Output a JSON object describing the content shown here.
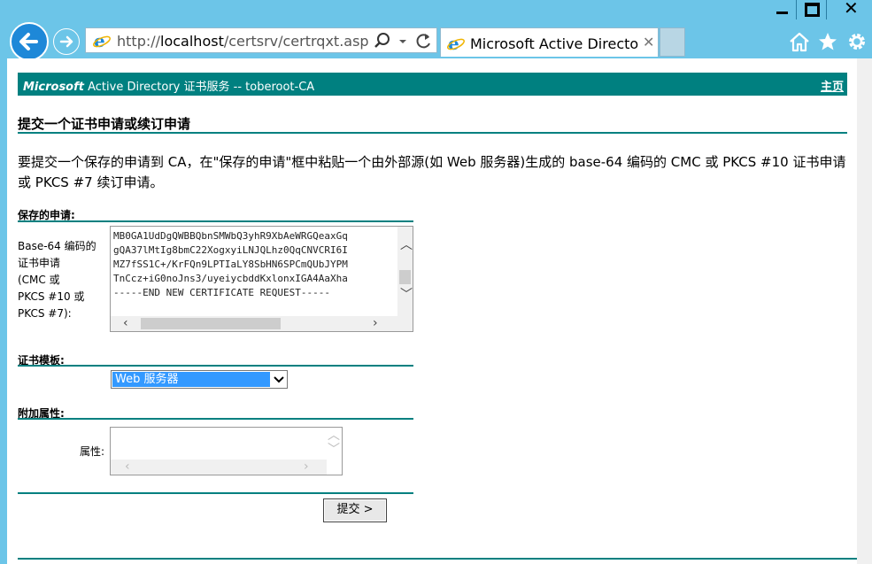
{
  "browser": {
    "url_prefix": "http://",
    "url_host": "localhost",
    "url_path": "/certsrv/certrqxt.asp",
    "tab_title": "Microsoft Active Directo...",
    "tab_close": "✕"
  },
  "header": {
    "brand": "Microsoft",
    "service": " Active Directory 证书服务  --  toberoot-CA",
    "home_link": "主页"
  },
  "page": {
    "title": "提交一个证书申请或续订申请",
    "intro": "要提交一个保存的申请到 CA，在\"保存的申请\"框中粘贴一个由外部源(如 Web 服务器)生成的 base-64 编码的 CMC 或 PKCS #10 证书申请或 PKCS #7 续订申请。"
  },
  "saved_request": {
    "section_label": "保存的申请:",
    "field_label_lines": [
      "Base-64 编码的",
      "证书申请",
      "(CMC 或",
      "PKCS #10 或",
      "PKCS #7):"
    ],
    "content_lines": [
      "MB0GA1UdDgQWBBQbnSMWbQ3yhR9XbAeWRGQeaxGq",
      "gQA37lMtIg8bmC22XogxyiLNJQLhz0QqCNVCRI6I",
      "MZ7fSS1C+/KrFQn9LPTIaLY8SbHN6SPCmQUbJYPM",
      "TnCcz+iG0noJns3/uyeiycbddKxlonxIGA4AaXha",
      "-----END NEW CERTIFICATE REQUEST-----"
    ]
  },
  "template": {
    "section_label": "证书模板:",
    "selected": "Web 服务器"
  },
  "attributes": {
    "section_label": "附加属性:",
    "field_label": "属性:",
    "value": ""
  },
  "submit_label": "提交 >",
  "icons": {
    "window": [
      "minimize-icon",
      "maximize-icon",
      "close-icon"
    ],
    "toolbar": [
      "back-icon",
      "forward-icon",
      "ie-icon",
      "search-icon",
      "dropdown-icon",
      "refresh-icon",
      "home-icon",
      "favorites-icon",
      "settings-icon"
    ]
  },
  "colors": {
    "accent": "#008080",
    "chrome": "#6cc5e8",
    "selection": "#3399ff"
  }
}
